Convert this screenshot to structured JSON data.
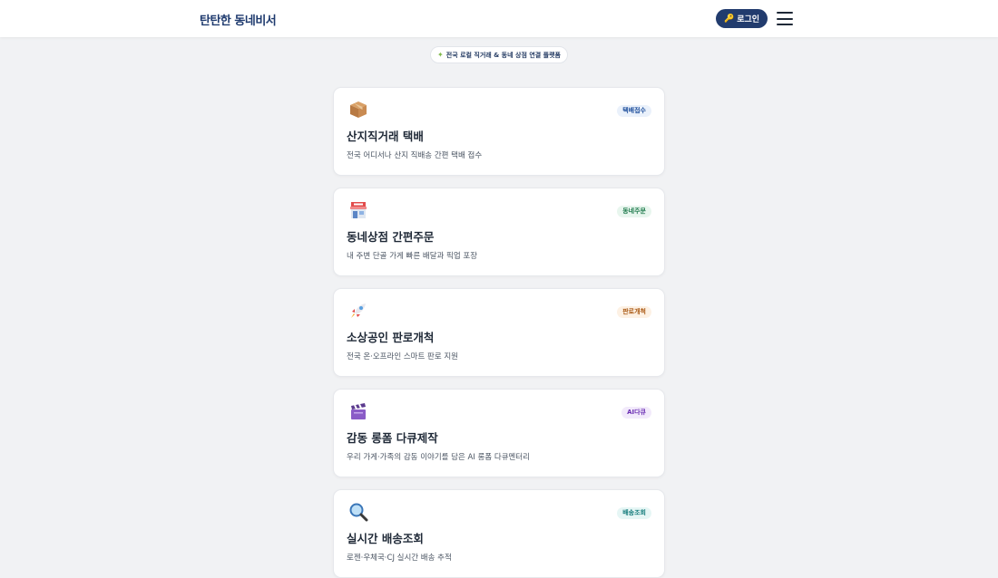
{
  "header": {
    "logo": "탄탄한 동네비서",
    "login_label": "로그인"
  },
  "tagline": "전국 로컬 직거래 & 동네 상점 연결 플랫폼",
  "colors": {
    "brand": "#1e3a6e",
    "login_bg": "#223c6e",
    "page_bg": "#f1f2f4"
  },
  "services": [
    {
      "icon": "package-icon",
      "badge": "택배접수",
      "badge_color": "#1e4f9c",
      "badge_bg": "#eaf1fb",
      "title": "산지직거래 택배",
      "desc": "전국 어디서나 산지 직배송 간편 택배 접수"
    },
    {
      "icon": "storefront-icon",
      "badge": "동네주문",
      "badge_color": "#1f7a4d",
      "badge_bg": "#e8f6ee",
      "title": "동네상점 간편주문",
      "desc": "내 주변 단골 가게 빠른 배달과 픽업 포장"
    },
    {
      "icon": "rocket-icon",
      "badge": "판로개척",
      "badge_color": "#a8560f",
      "badge_bg": "#fdf1e4",
      "title": "소상공인 판로개척",
      "desc": "전국 온·오프라인 스마트 판로 지원"
    },
    {
      "icon": "clapperboard-icon",
      "badge": "AI다큐",
      "badge_color": "#6b2fb3",
      "badge_bg": "#f2eafb",
      "title": "감동 롱폼 다큐제작",
      "desc": "우리 가게·가족의 감동 이야기를 담은 AI 롱폼 다큐멘터리"
    },
    {
      "icon": "magnifier-icon",
      "badge": "배송조회",
      "badge_color": "#127a7a",
      "badge_bg": "#e6f6f5",
      "title": "실시간 배송조회",
      "desc": "로젠·우체국·CJ 실시간 배송 추적"
    }
  ]
}
